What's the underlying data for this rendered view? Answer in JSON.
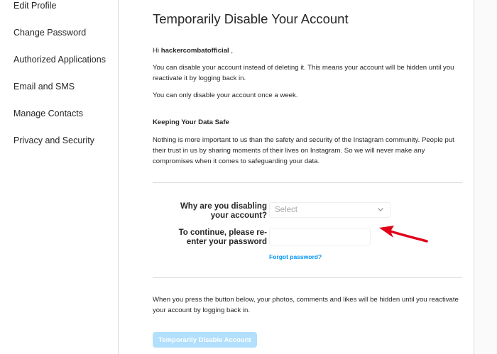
{
  "sidebar": {
    "items": [
      {
        "label": "Edit Profile"
      },
      {
        "label": "Change Password"
      },
      {
        "label": "Authorized Applications"
      },
      {
        "label": "Email and SMS"
      },
      {
        "label": "Manage Contacts"
      },
      {
        "label": "Privacy and Security"
      }
    ]
  },
  "main": {
    "title": "Temporarily Disable Your Account",
    "greeting_prefix": "Hi ",
    "username": "hackercombatofficial",
    "greeting_suffix": " ,",
    "para1": "You can disable your account instead of deleting it. This means your account will be hidden until you reactivate it by logging back in.",
    "para2": "You can only disable your account once a week.",
    "section_heading": "Keeping Your Data Safe",
    "para3": "Nothing is more important to us than the safety and security of the Instagram community. People put their trust in us by sharing moments of their lives on Instagram. So we will never make any compromises when it comes to safeguarding your data.",
    "form": {
      "reason_label": "Why are you disabling your account?",
      "reason_select_value": "Select",
      "password_label": "To continue, please re-enter your password",
      "password_value": "",
      "forgot_password": "Forgot password?"
    },
    "footer_note": "When you press the button below, your photos, comments and likes will be hidden until you reactivate your account by logging back in.",
    "submit_label": "Temporarily Disable Account"
  },
  "colors": {
    "link": "#0095f6",
    "button_disabled": "#b2dffc",
    "arrow_annotation": "#e0001a"
  },
  "icons": {
    "select_chevron": "chevron-down-icon"
  }
}
